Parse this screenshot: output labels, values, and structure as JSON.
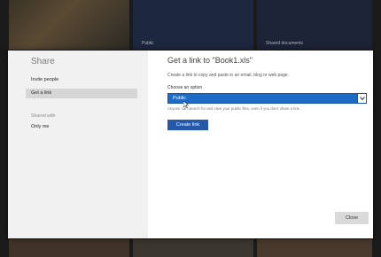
{
  "background": {
    "tile_captions": [
      "Public",
      "Shared documents"
    ]
  },
  "sidebar": {
    "title": "Share",
    "items": [
      {
        "label": "Invite people",
        "selected": false
      },
      {
        "label": "Get a link",
        "selected": true
      }
    ],
    "shared_with_label": "Shared with",
    "shared_with_value": "Only me"
  },
  "main": {
    "title": "Get a link to \"Book1.xls\"",
    "description": "Create a link to copy and paste in an email, blog or web page.",
    "option_label": "Choose an option",
    "select": {
      "value": "Public"
    },
    "note": "Anyone can search for and view your public files, even if you don't share a link.",
    "create_button": "Create link",
    "close_button": "Close"
  },
  "colors": {
    "accent": "#1e6bc6",
    "button": "#2458a8"
  }
}
